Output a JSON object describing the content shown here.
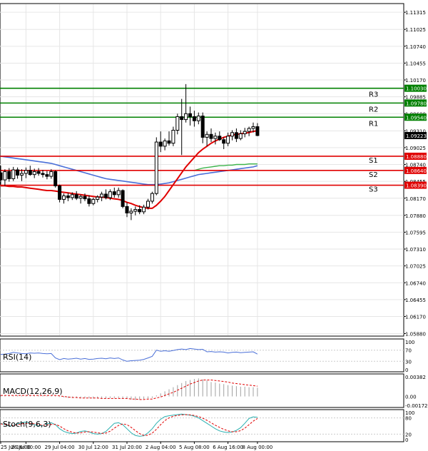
{
  "chart_data": {
    "type": "candlestick",
    "price_axis_ticks": [
      "1.11315",
      "1.11025",
      "1.10740",
      "1.10455",
      "1.10170",
      "1.09885",
      "1.09600",
      "1.09310",
      "1.09025",
      "1.08740",
      "1.08455",
      "1.08170",
      "1.07880",
      "1.07595",
      "1.07310",
      "1.07025",
      "1.06740",
      "1.06455",
      "1.06170",
      "1.05880"
    ],
    "price_range": [
      1.0585,
      1.1145
    ],
    "current_price": "1.09223",
    "time_labels": [
      {
        "label": "25 Jul 16:00",
        "i": 0
      },
      {
        "label": "26 Jul 00:00",
        "i": 6
      },
      {
        "label": "29 Jul 04:00",
        "i": 14
      },
      {
        "label": "30 Jul 12:00",
        "i": 22
      },
      {
        "label": "31 Jul 20:00",
        "i": 30
      },
      {
        "label": "2 Aug 04:00",
        "i": 38
      },
      {
        "label": "5 Aug 08:00",
        "i": 46
      },
      {
        "label": "6 Aug 16:00",
        "i": 54
      },
      {
        "label": "8 Aug 00:00",
        "i": 61
      }
    ],
    "levels": [
      {
        "name": "R3",
        "value": 1.1003,
        "label": "1.10030",
        "color": "#008000"
      },
      {
        "name": "R2",
        "value": 1.0978,
        "label": "1.09780",
        "color": "#008000"
      },
      {
        "name": "R1",
        "value": 1.0954,
        "label": "1.09540",
        "color": "#008000"
      },
      {
        "name": "S1",
        "value": 1.0888,
        "label": "1.08880",
        "color": "#e00000"
      },
      {
        "name": "S2",
        "value": 1.0864,
        "label": "1.08640",
        "color": "#e00000"
      },
      {
        "name": "S3",
        "value": 1.0839,
        "label": "1.08390",
        "color": "#e00000"
      }
    ],
    "candles": [
      [
        1.086,
        1.0872,
        1.084,
        1.0848
      ],
      [
        1.0848,
        1.0866,
        1.0838,
        1.0862
      ],
      [
        1.0862,
        1.0868,
        1.0845,
        1.085
      ],
      [
        1.085,
        1.087,
        1.0846,
        1.0865
      ],
      [
        1.0865,
        1.0869,
        1.085,
        1.0856
      ],
      [
        1.0856,
        1.0866,
        1.0846,
        1.0859
      ],
      [
        1.0859,
        1.0869,
        1.0851,
        1.0864
      ],
      [
        1.0864,
        1.0872,
        1.0855,
        1.0857
      ],
      [
        1.0857,
        1.0867,
        1.0851,
        1.0862
      ],
      [
        1.0862,
        1.0868,
        1.0855,
        1.0859
      ],
      [
        1.0859,
        1.0865,
        1.0852,
        1.0857
      ],
      [
        1.0857,
        1.0863,
        1.0849,
        1.0854
      ],
      [
        1.0854,
        1.0866,
        1.085,
        1.0862
      ],
      [
        1.0862,
        1.0864,
        1.0835,
        1.0838
      ],
      [
        1.0838,
        1.084,
        1.081,
        1.0815
      ],
      [
        1.0815,
        1.0825,
        1.0808,
        1.0821
      ],
      [
        1.0821,
        1.0826,
        1.0812,
        1.0818
      ],
      [
        1.0818,
        1.0827,
        1.0814,
        1.0823
      ],
      [
        1.0823,
        1.0829,
        1.0814,
        1.0817
      ],
      [
        1.0817,
        1.0823,
        1.0808,
        1.082
      ],
      [
        1.082,
        1.0825,
        1.0812,
        1.0816
      ],
      [
        1.0816,
        1.0822,
        1.0803,
        1.0808
      ],
      [
        1.0808,
        1.0818,
        1.0805,
        1.0815
      ],
      [
        1.0815,
        1.0822,
        1.081,
        1.0819
      ],
      [
        1.0819,
        1.0828,
        1.0812,
        1.0824
      ],
      [
        1.0824,
        1.0832,
        1.0815,
        1.0818
      ],
      [
        1.0818,
        1.0832,
        1.0814,
        1.0828
      ],
      [
        1.0828,
        1.0835,
        1.0818,
        1.0823
      ],
      [
        1.0823,
        1.0835,
        1.0818,
        1.083
      ],
      [
        1.083,
        1.0832,
        1.08,
        1.0803
      ],
      [
        1.0803,
        1.081,
        1.0785,
        1.0792
      ],
      [
        1.0792,
        1.08,
        1.078,
        1.0795
      ],
      [
        1.0795,
        1.0803,
        1.0788,
        1.0798
      ],
      [
        1.0798,
        1.0805,
        1.079,
        1.0794
      ],
      [
        1.0794,
        1.0806,
        1.079,
        1.0802
      ],
      [
        1.0802,
        1.0816,
        1.0798,
        1.0812
      ],
      [
        1.0812,
        1.0828,
        1.0808,
        1.0825
      ],
      [
        1.0825,
        1.092,
        1.0822,
        1.0912
      ],
      [
        1.0912,
        1.093,
        1.0895,
        1.0905
      ],
      [
        1.0905,
        1.0918,
        1.0898,
        1.0914
      ],
      [
        1.0914,
        1.093,
        1.0906,
        1.091
      ],
      [
        1.091,
        1.0938,
        1.0905,
        1.0932
      ],
      [
        1.0932,
        1.096,
        1.0925,
        1.0955
      ],
      [
        1.0955,
        1.0985,
        1.089,
        1.095
      ],
      [
        1.095,
        1.101,
        1.0945,
        1.096
      ],
      [
        1.096,
        1.0972,
        1.094,
        1.0955
      ],
      [
        1.0955,
        1.0965,
        1.0938,
        1.0948
      ],
      [
        1.0948,
        1.0962,
        1.0942,
        1.0956
      ],
      [
        1.0956,
        1.0962,
        1.091,
        1.092
      ],
      [
        1.092,
        1.093,
        1.0905,
        1.0925
      ],
      [
        1.0925,
        1.0935,
        1.0912,
        1.0918
      ],
      [
        1.0918,
        1.0928,
        1.0908,
        1.0922
      ],
      [
        1.0922,
        1.093,
        1.0914,
        1.0916
      ],
      [
        1.0916,
        1.092,
        1.09,
        1.091
      ],
      [
        1.091,
        1.0928,
        1.0905,
        1.0922
      ],
      [
        1.0922,
        1.0932,
        1.0915,
        1.0928
      ],
      [
        1.0928,
        1.0935,
        1.0912,
        1.0918
      ],
      [
        1.0918,
        1.0932,
        1.0915,
        1.0926
      ],
      [
        1.0926,
        1.0936,
        1.092,
        1.093
      ],
      [
        1.093,
        1.0938,
        1.0922,
        1.0935
      ],
      [
        1.0935,
        1.0945,
        1.0928,
        1.0938
      ],
      [
        1.0938,
        1.0944,
        1.0922,
        1.0923
      ]
    ],
    "ma_red": [
      1.0838,
      1.0838,
      1.0837,
      1.0837,
      1.0836,
      1.0836,
      1.0835,
      1.0834,
      1.0833,
      1.0832,
      1.0831,
      1.083,
      1.083,
      1.0829,
      1.0828,
      1.0827,
      1.0826,
      1.0825,
      1.0824,
      1.0823,
      1.0822,
      1.0821,
      1.082,
      1.0819,
      1.0819,
      1.0818,
      1.0817,
      1.0816,
      1.0815,
      1.0813,
      1.081,
      1.0808,
      1.0805,
      1.0803,
      1.0801,
      1.08,
      1.08,
      1.0805,
      1.0812,
      1.082,
      1.083,
      1.084,
      1.085,
      1.086,
      1.087,
      1.0878,
      1.0886,
      1.0894,
      1.09,
      1.0905,
      1.091,
      1.0914,
      1.0917,
      1.092,
      1.0922,
      1.0924,
      1.0925,
      1.0926,
      1.0927,
      1.0928,
      1.093,
      1.0931
    ],
    "ma_blue": [
      1.0888,
      1.0887,
      1.0886,
      1.0885,
      1.0884,
      1.0883,
      1.0882,
      1.0881,
      1.088,
      1.0879,
      1.0878,
      1.0877,
      1.0876,
      1.0874,
      1.0872,
      1.087,
      1.0868,
      1.0866,
      1.0864,
      1.0862,
      1.086,
      1.0858,
      1.0856,
      1.0854,
      1.0852,
      1.085,
      1.0849,
      1.0848,
      1.0847,
      1.0846,
      1.0845,
      1.0844,
      1.0843,
      1.0842,
      1.0841,
      1.084,
      1.084,
      1.084,
      1.0841,
      1.0842,
      1.0843,
      1.0845,
      1.0847,
      1.0849,
      1.0851,
      1.0853,
      1.0855,
      1.0857,
      1.0858,
      1.0859,
      1.086,
      1.0861,
      1.0862,
      1.0863,
      1.0864,
      1.0865,
      1.0866,
      1.0867,
      1.0868,
      1.0869,
      1.087,
      1.0872
    ],
    "ma_green": [
      1.0864,
      1.0864,
      1.0864,
      1.0864,
      1.0864,
      1.0864,
      1.0864,
      1.0864,
      1.0864,
      1.0864,
      1.0864,
      1.0864,
      1.0864,
      1.0864,
      1.0864,
      1.0864,
      1.0864,
      1.0864,
      1.0864,
      1.0864,
      1.0864,
      1.0864,
      1.0864,
      1.0864,
      1.0864,
      1.0864,
      1.0864,
      1.0864,
      1.0864,
      1.0864,
      1.0864,
      1.0864,
      1.0864,
      1.0864,
      1.0864,
      1.0864,
      1.0864,
      1.0864,
      1.0864,
      1.0864,
      1.0864,
      1.0864,
      1.0864,
      1.0864,
      1.0864,
      1.0864,
      1.0864,
      1.0866,
      1.0868,
      1.0869,
      1.087,
      1.0871,
      1.0872,
      1.0872,
      1.0873,
      1.0873,
      1.0874,
      1.0874,
      1.0874,
      1.0875,
      1.0875,
      1.0875
    ],
    "rsi": {
      "title": "RSI(14)",
      "ticks": [
        "100",
        "70",
        "30",
        "0"
      ],
      "tick_values": [
        100,
        70,
        30,
        0
      ],
      "values": [
        55,
        56,
        58,
        62,
        60,
        58,
        57,
        60,
        59,
        60,
        58,
        57,
        58,
        42,
        36,
        40,
        38,
        39,
        41,
        38,
        40,
        37,
        38,
        40,
        41,
        39,
        42,
        40,
        42,
        35,
        30,
        32,
        33,
        34,
        37,
        42,
        48,
        70,
        66,
        68,
        66,
        69,
        72,
        74,
        72,
        76,
        74,
        72,
        73,
        64,
        65,
        63,
        64,
        63,
        60,
        62,
        63,
        61,
        62,
        63,
        64,
        56
      ]
    },
    "macd": {
      "title": "MACD(12,26,9)",
      "ticks": [
        "0.00382",
        "0.00",
        "-0.001726"
      ],
      "tick_values": [
        0.00382,
        0.0,
        -0.001726
      ],
      "histogram": [
        0.0002,
        0.0002,
        0.0002,
        0.0002,
        0.0002,
        0.0002,
        0.0002,
        0.0002,
        0.0002,
        0.0002,
        0.0002,
        0.0002,
        0.0002,
        0.0001,
        -0.0001,
        -0.0002,
        -0.0003,
        -0.0003,
        -0.0003,
        -0.0003,
        -0.0003,
        -0.0003,
        -0.0004,
        -0.0004,
        -0.0004,
        -0.0004,
        -0.0003,
        -0.0003,
        -0.0003,
        -0.0004,
        -0.0005,
        -0.0006,
        -0.0007,
        -0.0006,
        -0.0005,
        -0.0004,
        -0.0003,
        0.0002,
        0.0006,
        0.001,
        0.0014,
        0.0018,
        0.0022,
        0.0026,
        0.003,
        0.0032,
        0.0034,
        0.0035,
        0.0033,
        0.0031,
        0.0028,
        0.0027,
        0.0025,
        0.0024,
        0.0022,
        0.0021,
        0.002,
        0.0019,
        0.0019,
        0.0018,
        0.0018,
        0.0017
      ],
      "signal": [
        0.0002,
        0.0002,
        0.0002,
        0.0002,
        0.0002,
        0.0002,
        0.0002,
        0.0002,
        0.0002,
        0.0002,
        0.0002,
        0.0002,
        0.0002,
        0.0002,
        0.0001,
        0.0,
        -0.0001,
        -0.0002,
        -0.0002,
        -0.0003,
        -0.0003,
        -0.0003,
        -0.0003,
        -0.0003,
        -0.0004,
        -0.0004,
        -0.0004,
        -0.0004,
        -0.0004,
        -0.0004,
        -0.0004,
        -0.0005,
        -0.0005,
        -0.0006,
        -0.0006,
        -0.0005,
        -0.0005,
        -0.0003,
        -0.0001,
        0.0002,
        0.0005,
        0.0008,
        0.0012,
        0.0016,
        0.002,
        0.0024,
        0.0027,
        0.003,
        0.0032,
        0.0032,
        0.0032,
        0.0031,
        0.003,
        0.0029,
        0.0028,
        0.0026,
        0.0025,
        0.0024,
        0.0023,
        0.0022,
        0.0021,
        0.002
      ]
    },
    "stoch": {
      "title": "Stoch(9,6,3)",
      "ticks": [
        "100",
        "80",
        "20",
        "0"
      ],
      "tick_values": [
        100,
        80,
        20,
        0
      ],
      "main": [
        60,
        55,
        50,
        52,
        58,
        62,
        65,
        60,
        55,
        50,
        52,
        58,
        62,
        55,
        40,
        30,
        25,
        22,
        24,
        30,
        32,
        28,
        22,
        20,
        22,
        30,
        45,
        60,
        62,
        55,
        40,
        25,
        15,
        12,
        14,
        25,
        40,
        60,
        75,
        85,
        88,
        90,
        92,
        94,
        92,
        90,
        86,
        80,
        70,
        60,
        50,
        40,
        32,
        28,
        26,
        28,
        34,
        44,
        60,
        78,
        84,
        82
      ],
      "signal": [
        58,
        56,
        53,
        52,
        55,
        58,
        60,
        60,
        58,
        55,
        53,
        54,
        56,
        56,
        50,
        40,
        32,
        27,
        24,
        25,
        28,
        29,
        28,
        25,
        23,
        24,
        31,
        42,
        52,
        58,
        55,
        45,
        33,
        22,
        15,
        16,
        24,
        38,
        55,
        70,
        80,
        86,
        89,
        91,
        92,
        91,
        89,
        85,
        79,
        71,
        62,
        53,
        45,
        38,
        32,
        29,
        29,
        33,
        42,
        55,
        68,
        78
      ]
    }
  }
}
